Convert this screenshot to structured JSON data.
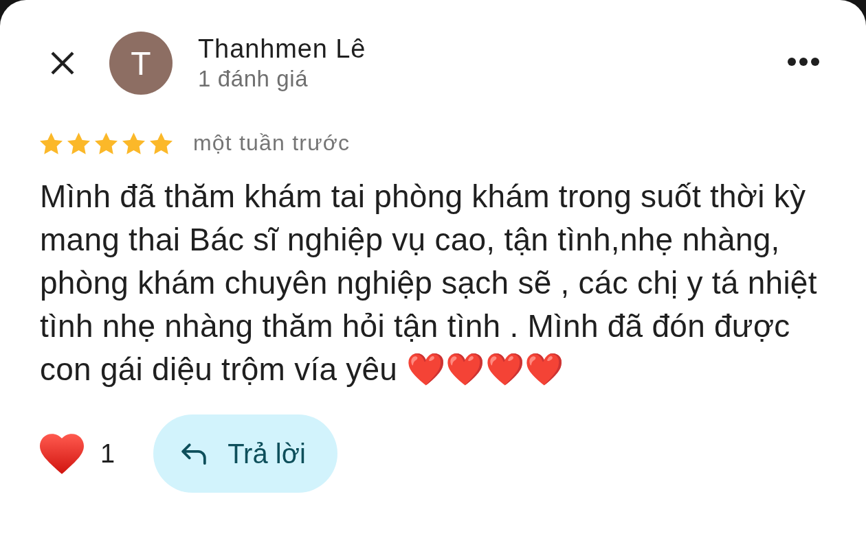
{
  "reviewer": {
    "avatar_letter": "T",
    "name": "Thanhmen Lê",
    "review_count": "1 đánh giá"
  },
  "review": {
    "stars": 5,
    "time": "một tuần trước",
    "text": "Mình đã thăm khám tai phòng khám trong suốt thời kỳ mang thai Bác sĩ nghiệp vụ cao, tận tình,nhẹ nhàng, phòng khám chuyên nghiệp sạch sẽ , các chị y tá nhiệt tình nhẹ nhàng thăm hỏi tận tình . Mình đã đón được con gái diệu trộm vía yêu ❤️❤️❤️❤️"
  },
  "actions": {
    "like_count": "1",
    "reply_label": "Trả lời"
  }
}
